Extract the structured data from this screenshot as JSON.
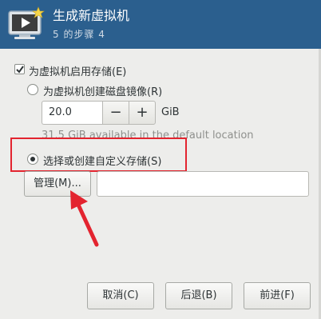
{
  "header": {
    "title": "生成新虚拟机",
    "step": "5 的步骤 4",
    "background": "#2b5f8e"
  },
  "storage": {
    "enable_label": "为虚拟机启用存储(E)",
    "enable_checked": true,
    "create_image_label": "为虚拟机创建磁盘镜像(R)",
    "size_value": "20.0",
    "size_unit": "GiB",
    "minus_symbol": "−",
    "plus_symbol": "+",
    "available_text": "31.5 GiB available in the default location",
    "custom_label": "选择或创建自定义存储(S)",
    "custom_selected": true,
    "manage_label": "管理(M)...",
    "path_value": ""
  },
  "footer": {
    "cancel_label": "取消(C)",
    "back_label": "后退(B)",
    "forward_label": "前进(F)"
  },
  "annotation": {
    "highlight_color": "#e3242f",
    "arrow_icon": "red-arrow-icon"
  }
}
